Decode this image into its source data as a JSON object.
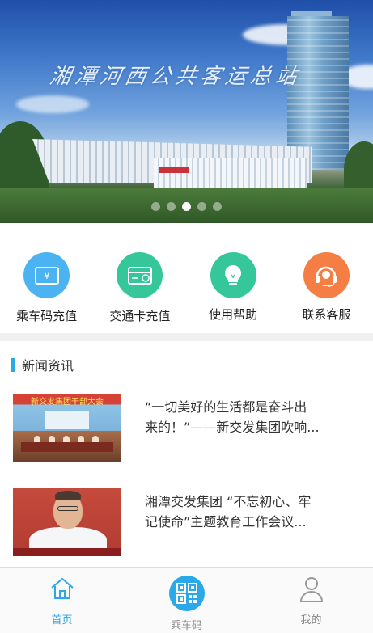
{
  "banner": {
    "title": "湘潭河西公共客运总站",
    "slide_count": 5,
    "active_slide": 3
  },
  "actions": [
    {
      "label": "乘车码充值",
      "icon": "wallet-icon",
      "color": "#4cb3f2"
    },
    {
      "label": "交通卡充值",
      "icon": "card-icon",
      "color": "#35c79a"
    },
    {
      "label": "使用帮助",
      "icon": "lightbulb-icon",
      "color": "#35c79a"
    },
    {
      "label": "联系客服",
      "icon": "headset-icon",
      "color": "#f57e45"
    }
  ],
  "news": {
    "section_title": "新闻资讯",
    "items": [
      {
        "line1": "“一切美好的生活都是奋斗出",
        "line2": "来的！”——新交发集团吹响...",
        "thumb_caption": "新交发集团干部大会"
      },
      {
        "line1": "湘潭交发集团 “不忘初心、牢",
        "line2": "记使命”主题教育工作会议..."
      }
    ]
  },
  "tabbar": {
    "home": "首页",
    "qr": "乘车码",
    "me": "我的",
    "active_color": "#2aa8e8",
    "inactive_color": "#888888"
  }
}
